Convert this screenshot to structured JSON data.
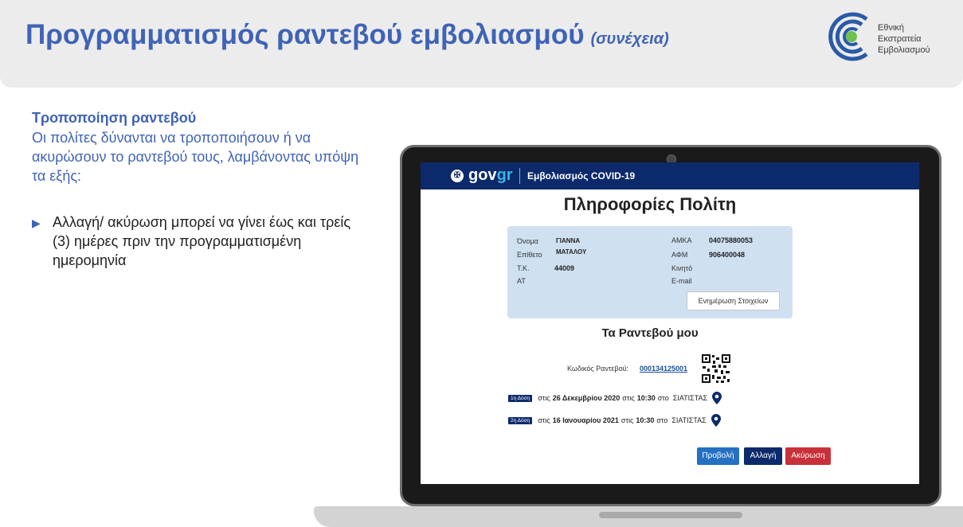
{
  "slide": {
    "title": "Προγραμματισμός ραντεβού εμβολιασμού",
    "subtitle": "(συνέχεια)",
    "logo_lines": [
      "Εθνική",
      "Εκστρατεία",
      "Εμβολιασμού"
    ]
  },
  "content": {
    "heading": "Τροποποίηση ραντεβού",
    "intro": "Οι πολίτες δύνανται να τροποποιήσουν ή να ακυρώσουν το ραντεβού τους, λαμβάνοντας υπόψη τα εξής:",
    "bullet_icon": "play-arrow-icon",
    "bullets": [
      "Αλλαγή/ ακύρωση μπορεί να γίνει έως και τρείς (3) ημέρες πριν την προγραμματισμένη ημερομηνία"
    ]
  },
  "portal": {
    "brand_gov": "gov",
    "brand_gr": "gr",
    "service": "Εμβολιασμός COVID-19",
    "page_title": "Πληροφορίες Πολίτη",
    "fields": {
      "first_name_label": "Όνομα",
      "first_name": "ΓΙΑΝΝΑ",
      "last_name_label": "Επίθετο",
      "last_name": "ΜΑΤΑΛΟΥ",
      "postcode_label": "Τ.Κ.",
      "postcode": "44009",
      "id_label": "ΑΤ",
      "id": "",
      "amka_label": "ΑΜΚΑ",
      "amka": "04075880053",
      "afm_label": "ΑΦΜ",
      "afm": "906400048",
      "mobile_label": "Κινητό",
      "mobile": "",
      "email_label": "E-mail",
      "email": ""
    },
    "update_button": "Ενημέρωση Στοιχείων",
    "appointments_title": "Τα Ραντεβού μου",
    "code_label": "Κωδικός Ραντεβού:",
    "code": "000134125001",
    "doses": [
      {
        "badge": "1η Δόση",
        "pre": "στις",
        "date": "26 Δεκεμβρίου 2020",
        "mid": "στις",
        "time": "10:30",
        "post": "στο",
        "place": "ΣΙΑΤΙΣΤΑΣ"
      },
      {
        "badge": "2η Δόση",
        "pre": "στις",
        "date": "16 Ιανουαρίου 2021",
        "mid": "στις",
        "time": "10:30",
        "post": "στο",
        "place": "ΣΙΑΤΙΣΤΑΣ"
      }
    ],
    "buttons": {
      "preview": "Προβολή",
      "change": "Αλλαγή",
      "cancel": "Ακύρωση"
    },
    "colors": {
      "navy": "#0c2a6b",
      "blue": "#2470c2",
      "red": "#c9313a",
      "panel": "#cfe0f1"
    }
  }
}
